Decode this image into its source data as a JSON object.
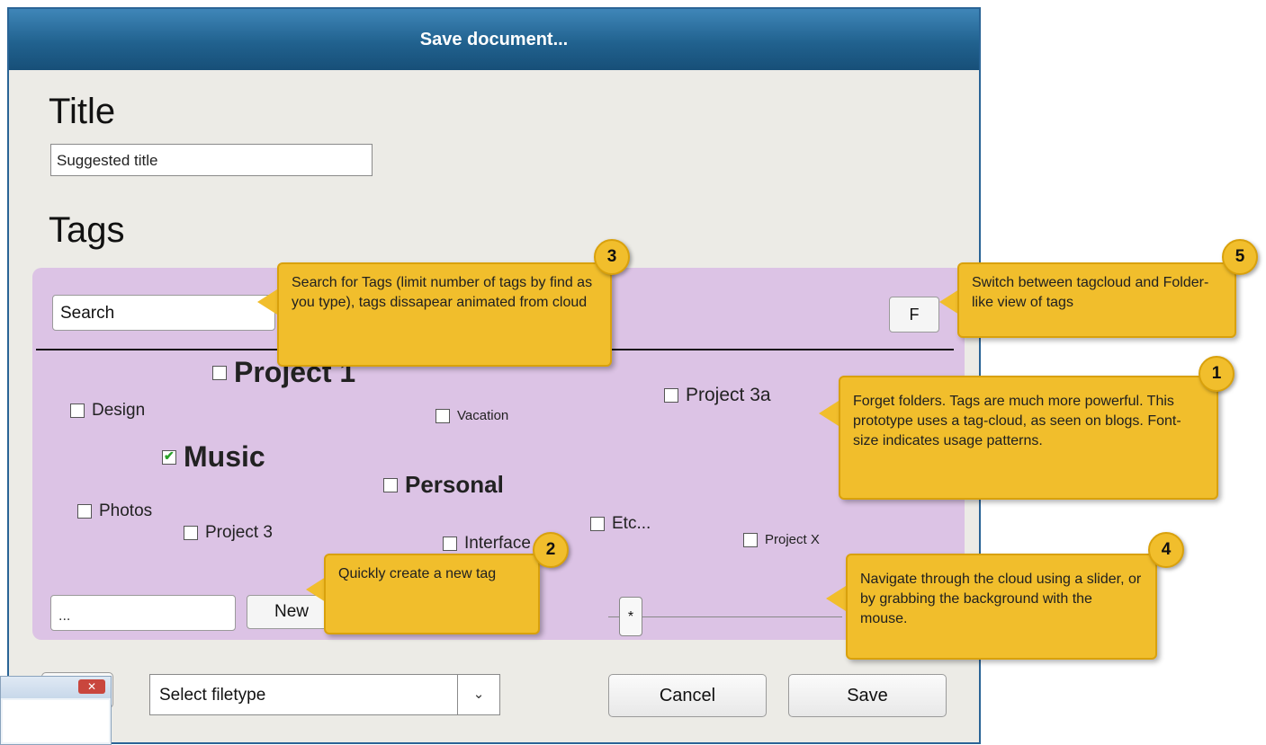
{
  "dialog": {
    "title": "Save document...",
    "title_label": "Title",
    "title_value": "Suggested title",
    "tags_label": "Tags"
  },
  "tag_panel": {
    "search_value": "Search",
    "view_toggle_label": "F",
    "tags": [
      {
        "label": "Project 1",
        "checked": false
      },
      {
        "label": "Design",
        "checked": false
      },
      {
        "label": "Vacation",
        "checked": false
      },
      {
        "label": "Project 3a",
        "checked": false
      },
      {
        "label": "Music",
        "checked": true
      },
      {
        "label": "Personal",
        "checked": false
      },
      {
        "label": "Photos",
        "checked": false
      },
      {
        "label": "Project 3",
        "checked": false
      },
      {
        "label": "Interface",
        "checked": false
      },
      {
        "label": "Etc...",
        "checked": false
      },
      {
        "label": "Project X",
        "checked": false
      }
    ],
    "new_tag_value": "...",
    "new_button_label": "New",
    "slider_thumb_label": "*"
  },
  "footer": {
    "filetype_value": "Select filetype",
    "cancel_label": "Cancel",
    "save_label": "Save"
  },
  "annotations": [
    {
      "number": "1",
      "text": "Forget folders. Tags are much more powerful. This prototype uses a tag-cloud, as seen on blogs. Font-size indicates usage patterns."
    },
    {
      "number": "2",
      "text": "Quickly create a new tag"
    },
    {
      "number": "3",
      "text": "Search for Tags (limit number of tags by find as you type), tags dissapear animated from cloud"
    },
    {
      "number": "4",
      "text": "Navigate through the cloud using a slider, or by grabbing the background with the mouse."
    },
    {
      "number": "5",
      "text": "Switch between tagcloud and Folder-like view of tags"
    }
  ],
  "mini_window": {
    "close_icon": "close-icon"
  },
  "colors": {
    "titlebar": "#21628f",
    "tag_panel": "#dcc3e5",
    "callout": "#f1be2c",
    "dialog_bg": "#ecebe6"
  }
}
